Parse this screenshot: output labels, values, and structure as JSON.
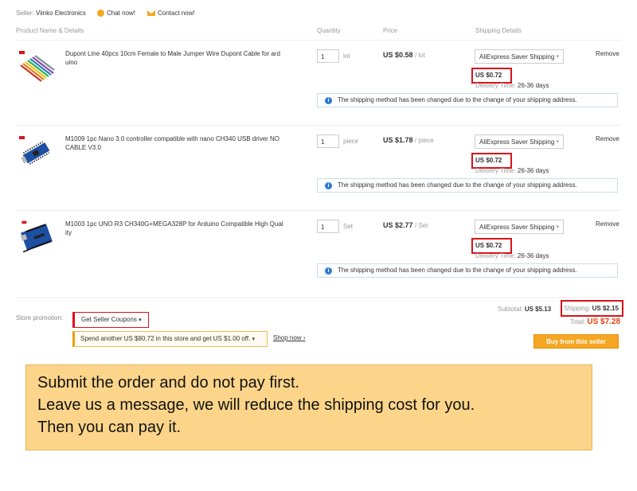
{
  "seller": {
    "label": "Seller:",
    "name": "Viinko Electronics",
    "chat_label": "Chat now!",
    "contact_label": "Contact now!"
  },
  "headers": {
    "product": "Product Name & Details",
    "quantity": "Quantity",
    "price": "Price",
    "shipping": "Shipping Details"
  },
  "items": [
    {
      "name": "Dupont Line 40pcs 10cm Female to Male Jumper Wire Dupont Cable for ard uino",
      "qty": "1",
      "unit": "lot",
      "price": "US $0.58",
      "price_unit": "/ lot",
      "shipping_method": "AliExpress Saver Shipping",
      "ship_cost": "US $0.72",
      "delivery_label": "Delivery Time:",
      "delivery_days": "26-36 days",
      "remove": "Remove",
      "notice": "The shipping method has been changed due to the change of your shipping address."
    },
    {
      "name": "M1009 1pc Nano 3.0 controller compatible with nano CH340 USB driver NO CABLE V3.0",
      "qty": "1",
      "unit": "piece",
      "price": "US $1.78",
      "price_unit": "/ piece",
      "shipping_method": "AliExpress Saver Shipping",
      "ship_cost": "US $0.72",
      "delivery_label": "Delivery Time:",
      "delivery_days": "26-36 days",
      "remove": "Remove",
      "notice": "The shipping method has been changed due to the change of your shipping address."
    },
    {
      "name": "M1003 1pc UNO R3 CH340G+MEGA328P for Arduino Compatible High Qual ity",
      "qty": "1",
      "unit": "Set",
      "price": "US $2.77",
      "price_unit": "/ Set",
      "shipping_method": "AliExpress Saver Shipping",
      "ship_cost": "US $0.72",
      "delivery_label": "Delivery Time:",
      "delivery_days": "26-36 days",
      "remove": "Remove",
      "notice": "The shipping method has been changed due to the change of your shipping address."
    }
  ],
  "promotion": {
    "label": "Store promotion:",
    "coupon_label": "Get Seller Coupons",
    "spend_text": "Spend another US $80.72 in this store and get US $1.00 off.",
    "shop_now": "Shop now"
  },
  "summary": {
    "subtotal_label": "Subtotal:",
    "subtotal_value": "US $5.13",
    "shipping_label": "Shipping:",
    "shipping_value": "US $2.15",
    "total_label": "Total:",
    "total_value": "US $7.28",
    "buy_button": "Buy from this seller"
  },
  "message": {
    "line1": "Submit the order and do not pay first.",
    "line2": "Leave us a message, we will reduce the shipping cost for you.",
    "line3": "Then you can pay it."
  },
  "colors": {
    "highlight_red": "#d9131b",
    "accent_orange": "#f5a623",
    "total_orange": "#e8400c",
    "info_blue": "#2c7bd6",
    "message_bg": "#fcd58a"
  }
}
